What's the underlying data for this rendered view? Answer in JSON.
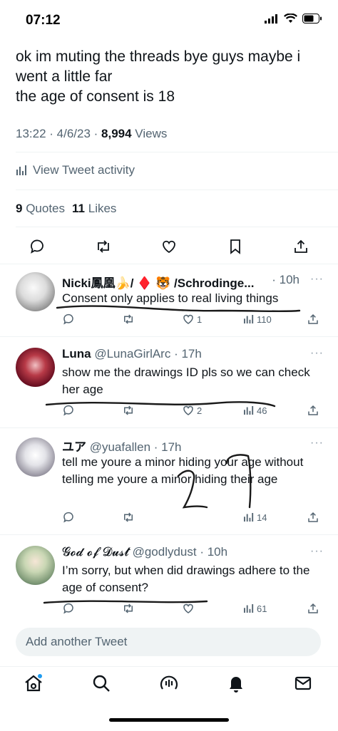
{
  "status_bar": {
    "time": "07:12"
  },
  "tweet": {
    "text": "ok im muting the threads bye guys maybe i\nwent a little far\nthe age of consent is 18",
    "time": "13:22 · 4/6/23 · ",
    "views_count": "8,994",
    "views_label": " Views",
    "activity_label": "View Tweet activity",
    "quotes_count": "9",
    "quotes_label": "Quotes",
    "likes_count": "11",
    "likes_label": "Likes"
  },
  "replies": [
    {
      "name": "Nicki鳳凰🍌/ ♦️ 🐯 /Schrodinge...",
      "handle": "",
      "time": " · 10h",
      "text": "Consent only applies to real living things",
      "reply_count": "",
      "retweet_count": "",
      "like_count": "1",
      "views": "110"
    },
    {
      "name": "Luna",
      "handle": " @LunaGirlArc",
      "time": " · 17h",
      "text": "show me the drawings ID pls so we can check her age",
      "reply_count": "",
      "retweet_count": "",
      "like_count": "2",
      "views": "46"
    },
    {
      "name": "ユア",
      "handle": " @yuafallen",
      "time": " · 17h",
      "text": "tell me youre a minor hiding your age without telling me youre a minor hiding their age",
      "reply_count": "",
      "retweet_count": "",
      "like_count": "",
      "views": "14"
    },
    {
      "name": "𝓖𝓸𝓭 𝓸𝓯 𝓓𝓾𝓼𝓽",
      "handle": " @godlydust",
      "time": " · 10h",
      "text": "I’m sorry, but when did drawings adhere to the age of consent?",
      "reply_count": "",
      "retweet_count": "",
      "like_count": "",
      "views": "61"
    }
  ],
  "more_label": "···",
  "compose_placeholder": "Add another Tweet",
  "colors": {
    "text": "#0f1419",
    "secondary": "#536471",
    "accent": "#1d9bf0",
    "scribble": "#1a1a1a"
  },
  "icons": [
    "reply-icon",
    "retweet-icon",
    "like-icon",
    "bookmark-icon",
    "share-icon",
    "views-icon",
    "home-icon",
    "search-icon",
    "spaces-icon",
    "notifications-icon",
    "messages-icon"
  ]
}
